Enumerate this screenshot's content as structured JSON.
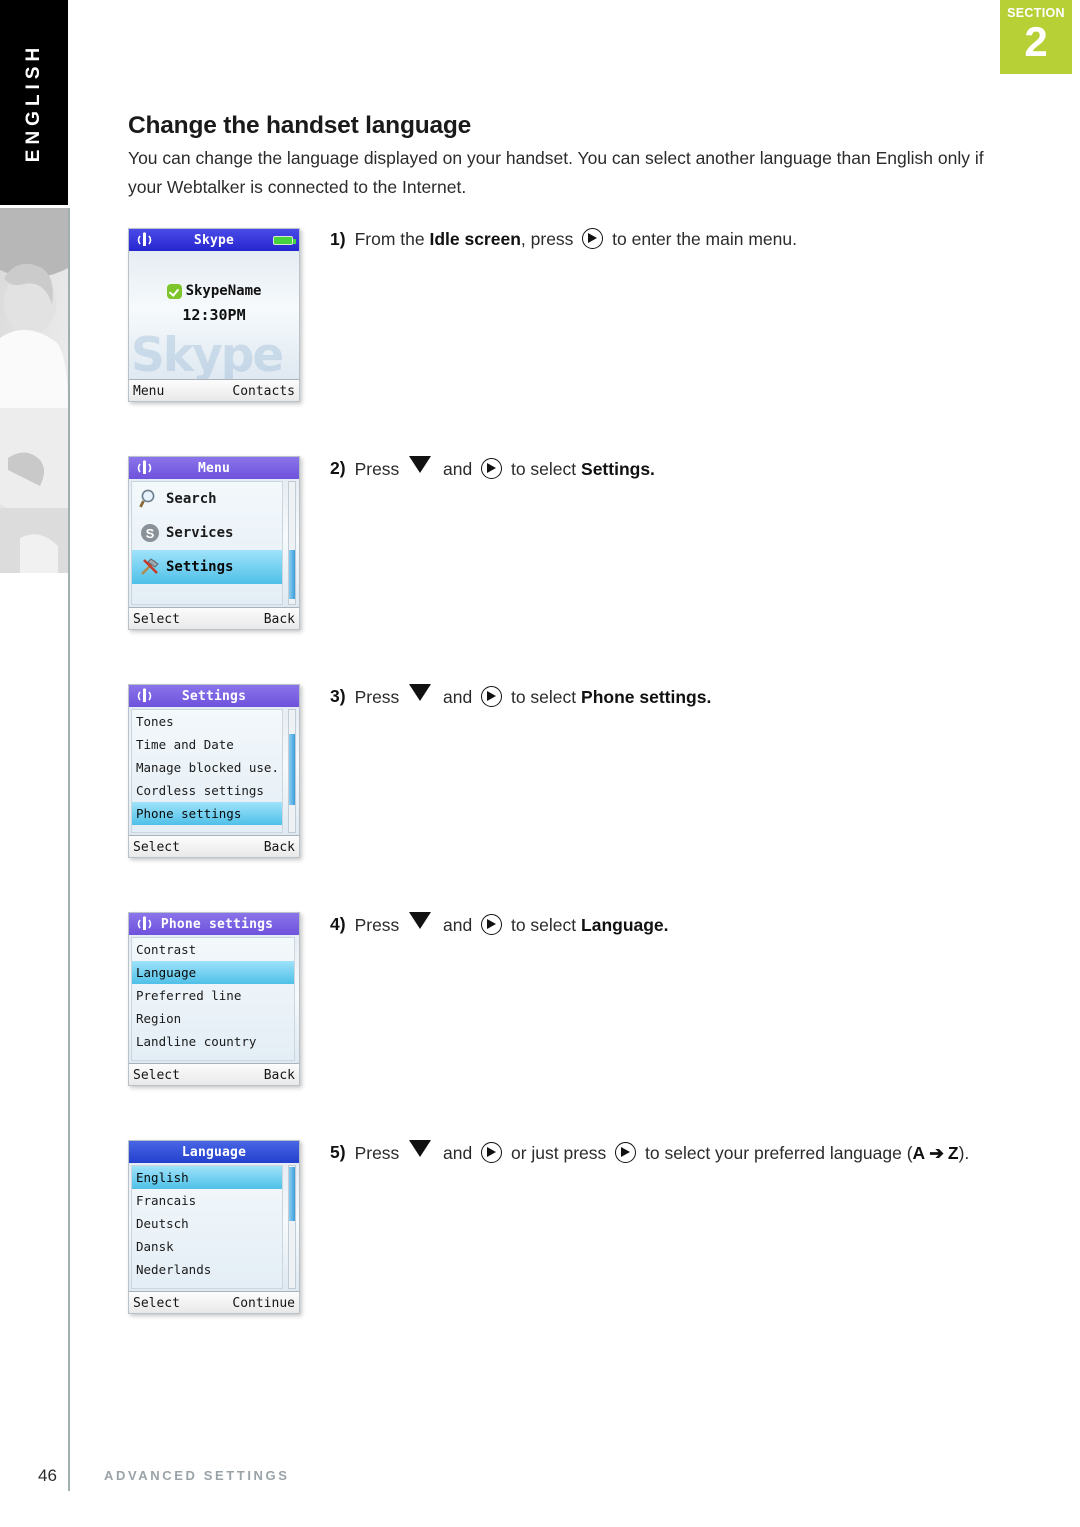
{
  "sidebar": {
    "language_tab": "ENGLISH",
    "photo_alt": "woman-smiling-photo"
  },
  "section_tab": {
    "label": "SECTION",
    "number": "2",
    "color": "#b7d036"
  },
  "page": {
    "title": "Change the handset language",
    "intro": "You can change the language displayed on your handset. You can select another language than English only if your Webtalker is connected to the Internet."
  },
  "steps": [
    {
      "number": "1)",
      "pre": "From the ",
      "bold1": "Idle screen",
      "mid": ", press ",
      "icon1": "nav-right-icon",
      "post": " to enter the main menu.",
      "has_down": false
    },
    {
      "number": "2)",
      "pre": "Press ",
      "icon_down": "down-arrow-icon",
      "mid": " and ",
      "icon1": "nav-right-icon",
      "post": " to select ",
      "bold_end": "Settings.",
      "has_down": true
    },
    {
      "number": "3)",
      "pre": "Press ",
      "icon_down": "down-arrow-icon",
      "mid": " and ",
      "icon1": "nav-right-icon",
      "post": " to select ",
      "bold_end": "Phone settings.",
      "has_down": true
    },
    {
      "number": "4)",
      "pre": "Press ",
      "icon_down": "down-arrow-icon",
      "mid": " and ",
      "icon1": "nav-right-icon",
      "post": " to select ",
      "bold_end": "Language.",
      "has_down": true
    },
    {
      "number": "5)",
      "pre": "Press ",
      "icon_down": "down-arrow-icon",
      "mid": " and ",
      "icon1": "nav-right-icon",
      "post": " or just press ",
      "icon2": "nav-right-icon",
      "post2": " to select your preferred language (",
      "az_a": "A",
      "az_arrow": "➔",
      "az_z": "Z",
      "post3": ").",
      "has_down": true
    }
  ],
  "screens": [
    {
      "name": "idle-screen",
      "title": "Skype",
      "title_color": "#2626cf",
      "signal_icon": "signal-antenna-icon",
      "battery_icon": "battery-full-icon",
      "status_icon": "online-check-icon",
      "user_name": "SkypeName",
      "time": "12:30PM",
      "watermark": "Skype",
      "softkey_left": "Menu",
      "softkey_right": "Contacts"
    },
    {
      "name": "menu-screen",
      "title": "Menu",
      "title_color": "#6e52dc",
      "signal_icon": "signal-antenna-icon",
      "items": [
        {
          "label": "Search",
          "icon": "magnifier-icon",
          "selected": false
        },
        {
          "label": "Services",
          "icon": "skype-s-icon",
          "selected": false
        },
        {
          "label": "Settings",
          "icon": "tools-hammer-icon",
          "selected": true
        }
      ],
      "softkey_left": "Select",
      "softkey_right": "Back"
    },
    {
      "name": "settings-screen",
      "title": "Settings",
      "title_color": "#6e52dc",
      "signal_icon": "signal-antenna-icon",
      "items": [
        {
          "label": "Tones",
          "selected": false
        },
        {
          "label": "Time and Date",
          "selected": false
        },
        {
          "label": "Manage blocked use...",
          "selected": false
        },
        {
          "label": "Cordless settings",
          "selected": false
        },
        {
          "label": "Phone settings",
          "selected": true
        }
      ],
      "softkey_left": "Select",
      "softkey_right": "Back"
    },
    {
      "name": "phone-settings-screen",
      "title": "Phone settings",
      "title_color": "#6e52dc",
      "signal_icon": "signal-antenna-icon",
      "items": [
        {
          "label": "Contrast",
          "selected": false
        },
        {
          "label": "Language",
          "selected": true
        },
        {
          "label": "Preferred line",
          "selected": false
        },
        {
          "label": "Region",
          "selected": false
        },
        {
          "label": "Landline country",
          "selected": false
        }
      ],
      "softkey_left": "Select",
      "softkey_right": "Back"
    },
    {
      "name": "language-screen",
      "title": "Language",
      "title_color": "#2340cd",
      "signal_icon": "",
      "items": [
        {
          "label": "English",
          "selected": true
        },
        {
          "label": "Francais",
          "selected": false
        },
        {
          "label": "Deutsch",
          "selected": false
        },
        {
          "label": "Dansk",
          "selected": false
        },
        {
          "label": "Nederlands",
          "selected": false
        }
      ],
      "softkey_left": "Select",
      "softkey_right": "Continue"
    }
  ],
  "footer": {
    "page_number": "46",
    "label": "ADVANCED SETTINGS"
  }
}
